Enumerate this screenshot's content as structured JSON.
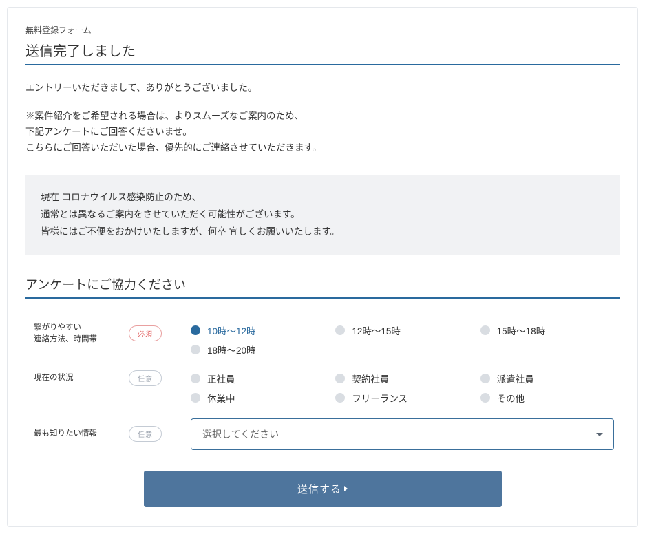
{
  "form_name": "無料登録フォーム",
  "page_title": "送信完了しました",
  "intro": {
    "p1": "エントリーいただきまして、ありがとうございました。",
    "p2_l1": "※案件紹介をご希望される場合は、よりスムーズなご案内のため、",
    "p2_l2": "下記アンケートにご回答くださいませ。",
    "p2_l3": "こちらにご回答いただいた場合、優先的にご連絡させていただきます。"
  },
  "notice": {
    "l1": "現在 コロナウイルス感染防止のため、",
    "l2": "通常とは異なるご案内をさせていただく可能性がございます。",
    "l3": "皆様にはご不便をおかけいたしますが、何卒 宜しくお願いいたします。"
  },
  "survey_title": "アンケートにご協力ください",
  "badges": {
    "required": "必須",
    "optional": "任意"
  },
  "fields": {
    "contact": {
      "label_l1": "繋がりやすい",
      "label_l2": "連絡方法、時間帯",
      "options": {
        "o1": "10時～12時",
        "o2": "12時～15時",
        "o3": "15時～18時",
        "o4": "18時～20時"
      },
      "selected": "o1"
    },
    "status": {
      "label": "現在の状況",
      "options": {
        "o1": "正社員",
        "o2": "契約社員",
        "o3": "派遣社員",
        "o4": "休業中",
        "o5": "フリーランス",
        "o6": "その他"
      }
    },
    "info": {
      "label": "最も知りたい情報",
      "placeholder": "選択してください"
    }
  },
  "submit_label": "送信する"
}
